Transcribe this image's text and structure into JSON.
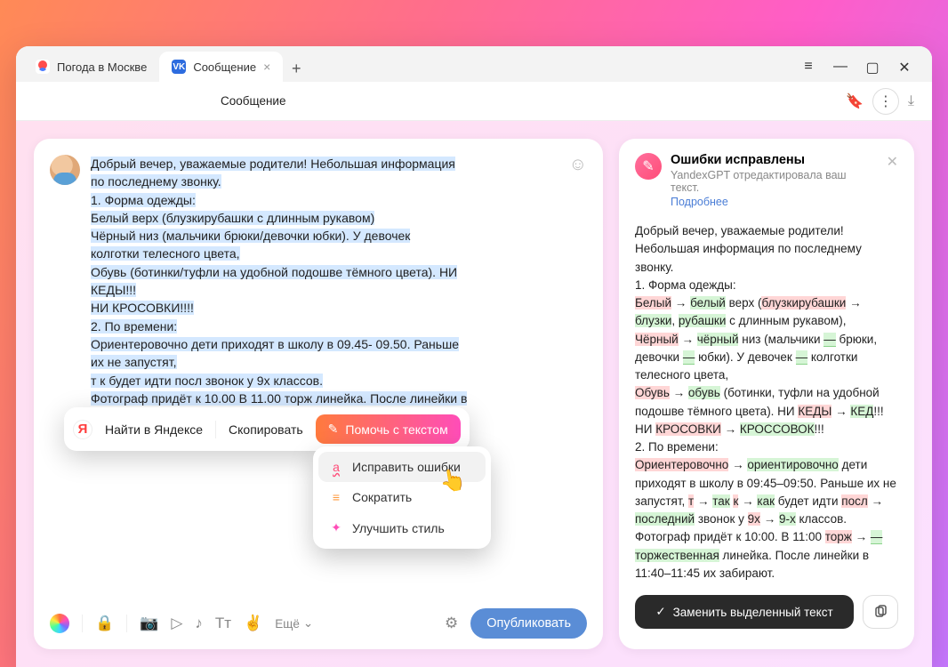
{
  "tabs": [
    {
      "label": "Погода в Москве",
      "icon": "weather"
    },
    {
      "label": "Сообщение",
      "icon": "vk"
    }
  ],
  "newTab": "+",
  "win": {
    "menu": "≡",
    "min": "—",
    "max": "▢",
    "close": "✕"
  },
  "addr": {
    "text": "Сообщение"
  },
  "avatarName": "user-avatar",
  "message": {
    "lines": [
      "Добрый вечер, уважаемые родители! Небольшая информация",
      "по последнему звонку.",
      "1. Форма одежды:",
      "Белый верх (блузкирубашки с длинным рукавом)",
      "Чёрный низ (мальчики брюки/девочки юбки). У девочек",
      "колготки телесного цвета,",
      "Обувь (ботинки/туфли на удобной подошве тёмного цвета). НИ",
      "КЕДЫ!!!",
      "НИ КРОСОВКИ!!!!",
      "2. По времени:",
      "Ориентеровочно дети приходят в школу в 09.45- 09.50. Раньше",
      "их не запустят,",
      "т к будет идти посл звонок у 9х классов.",
      "Фотограф придёт к 10.00 В 11.00 торж линейка. После линейки в",
      "11.40-11.45 их забирают"
    ]
  },
  "toolbarMore": "Ещё",
  "publish": "Опубликовать",
  "popup": {
    "search": "Найти в Яндексе",
    "copy": "Скопировать",
    "help": "Помочь с текстом"
  },
  "menu": {
    "fix": "Исправить ошибки",
    "shorten": "Сократить",
    "style": "Улучшить стиль"
  },
  "panel": {
    "title": "Ошибки исправлены",
    "sub": "YandexGPT отредактировала ваш текст.",
    "link": "Подробнее",
    "replace": "Заменить выделенный текст"
  },
  "diff": {
    "p1": "Добрый вечер, уважаемые родители! Небольшая информация по последнему звонку.",
    "p2": "1. Форма одежды:",
    "r1a": "Белый",
    "r1b": "белый",
    "r1c": " верх (",
    "r1d": "блузкирубашки",
    "r1e": "блузки",
    "r1f": ", ",
    "r1g": "рубашки",
    "r1h": " с длинным рукавом),",
    "r2a": "Чёрный",
    "r2b": "чёрный",
    "r2c": " низ (мальчики ",
    "r2d": "—",
    "r2e": " брюки, девочки ",
    "r2f": "—",
    "r2g": " юбки). У девочек ",
    "r2h": "—",
    "r2i": " колготки телесного цвета,",
    "r3a": "Обувь",
    "r3b": "обувь",
    "r3c": " (ботинки, туфли на удобной подошве тёмного цвета). НИ ",
    "r3d": "КЕДЫ",
    "r3e": "КЕД",
    "r3f": "!!!",
    "r4a": "НИ ",
    "r4b": "КРОСОВКИ",
    "r4c": "КРОССОВОК",
    "r4d": "!!!",
    "p5": "2. По времени:",
    "r6a": "Ориентеровочно",
    "r6b": "ориентировочно",
    "r6c": " дети приходят в школу в 09:45–09:50. Раньше их не запустят, ",
    "r6d": "т",
    "r6e": "так",
    "r6f": " ",
    "r6g": "к",
    "r6h": "как",
    "r6i": " будет идти ",
    "r6j": "посл",
    "r6k": "последний",
    "r6l": " звонок у ",
    "r6m": "9х",
    "r6n": "9-х",
    "r6o": " классов.",
    "r7a": "Фотограф придёт к 10:00. В 11:00 ",
    "r7b": "торж",
    "r7c": "—",
    "r7d": " ",
    "r7e": "торжественная",
    "r7f": " линейка. После линейки в 11:40–11:45 их забирают."
  }
}
